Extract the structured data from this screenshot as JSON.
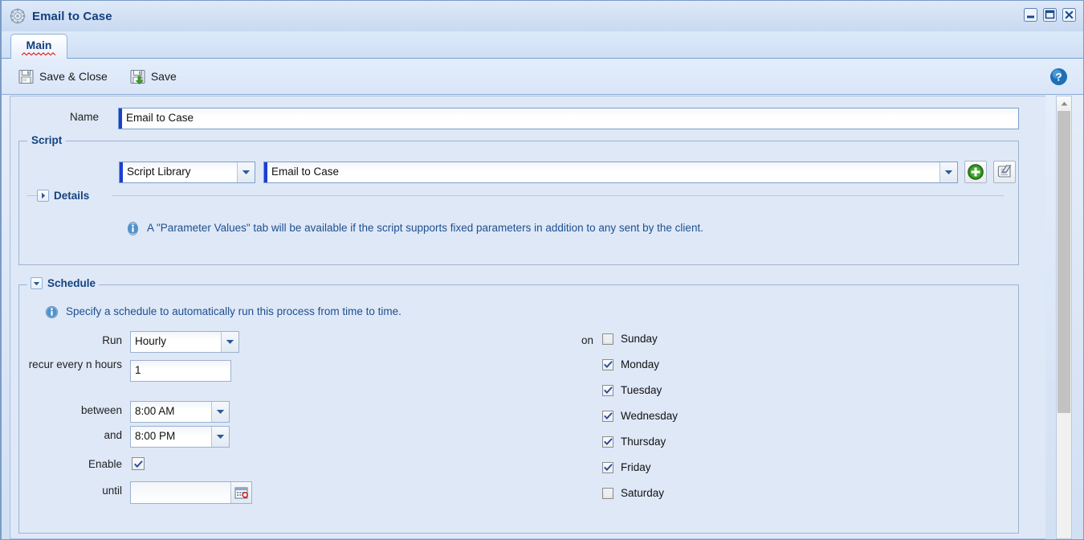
{
  "window": {
    "title": "Email to Case",
    "icon": "gear-icon",
    "controls": {
      "minimize": "minimize-icon",
      "maximize": "maximize-icon",
      "close": "close-icon"
    }
  },
  "tabs": [
    {
      "label": "Main",
      "active": true
    }
  ],
  "toolbar": {
    "save_close_label": "Save & Close",
    "save_label": "Save",
    "help": "help-icon"
  },
  "form": {
    "name": {
      "label": "Name",
      "value": "Email to Case"
    }
  },
  "script_group": {
    "title": "Script",
    "source": {
      "value": "Script Library",
      "options": [
        "Script Library"
      ]
    },
    "script": {
      "value": "Email to Case"
    },
    "add_button": "add-icon",
    "edit_script_button": "script-icon",
    "details": {
      "label": "Details",
      "expanded": false
    },
    "info": "A \"Parameter Values\" tab will be available if the script supports fixed parameters in addition to any sent by the client."
  },
  "schedule_group": {
    "title": "Schedule",
    "expanded": true,
    "info": "Specify a schedule to automatically run this process from time to time.",
    "fields": {
      "run": {
        "label": "Run",
        "value": "Hourly",
        "options": [
          "Hourly"
        ]
      },
      "recur": {
        "label": "recur every n hours",
        "value": "1"
      },
      "between": {
        "label": "between",
        "value": "8:00 AM"
      },
      "and": {
        "label": "and",
        "value": "8:00 PM"
      },
      "enable": {
        "label": "Enable",
        "checked": true
      },
      "until": {
        "label": "until",
        "value": "",
        "calendar_button": "calendar-icon"
      }
    },
    "days": {
      "label": "on",
      "items": [
        {
          "label": "Sunday",
          "checked": false
        },
        {
          "label": "Monday",
          "checked": true
        },
        {
          "label": "Tuesday",
          "checked": true
        },
        {
          "label": "Wednesday",
          "checked": true
        },
        {
          "label": "Thursday",
          "checked": true
        },
        {
          "label": "Friday",
          "checked": true
        },
        {
          "label": "Saturday",
          "checked": false
        }
      ]
    }
  },
  "colors": {
    "title_text": "#12407e",
    "accent_required": "#1a3fd4",
    "info_text": "#1d4f91",
    "panel_bg": "#dfe8f7",
    "border": "#9fb4d0"
  }
}
